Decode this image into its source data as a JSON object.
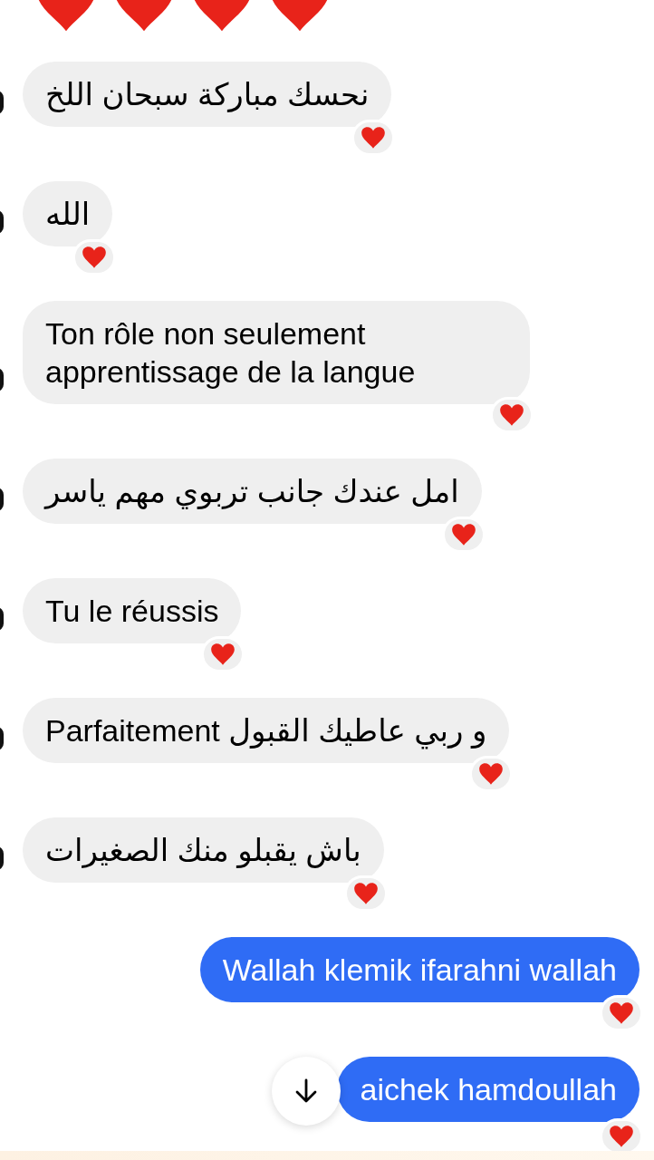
{
  "messages": [
    {
      "kind": "received",
      "text": "نحسك مباركة سبحان اللخ",
      "reacted": true
    },
    {
      "kind": "received",
      "text": "الله",
      "reacted": true
    },
    {
      "kind": "received",
      "text": "Ton rôle non seulement apprentissage de la langue",
      "reacted": true
    },
    {
      "kind": "received",
      "text": "امل عندك جانب تربوي مهم ياسر",
      "reacted": true
    },
    {
      "kind": "received",
      "text": "Tu le réussis",
      "reacted": true
    },
    {
      "kind": "received",
      "text": "و ربي عاطيك القبول Parfaitement",
      "reacted": true
    },
    {
      "kind": "received",
      "text": "باش يقبلو منك الصغيرات",
      "reacted": true
    },
    {
      "kind": "sent",
      "text": "Wallah klemik ifarahni wallah",
      "reacted": true
    },
    {
      "kind": "sent",
      "text": "aichek hamdoullah",
      "reacted": true
    }
  ]
}
